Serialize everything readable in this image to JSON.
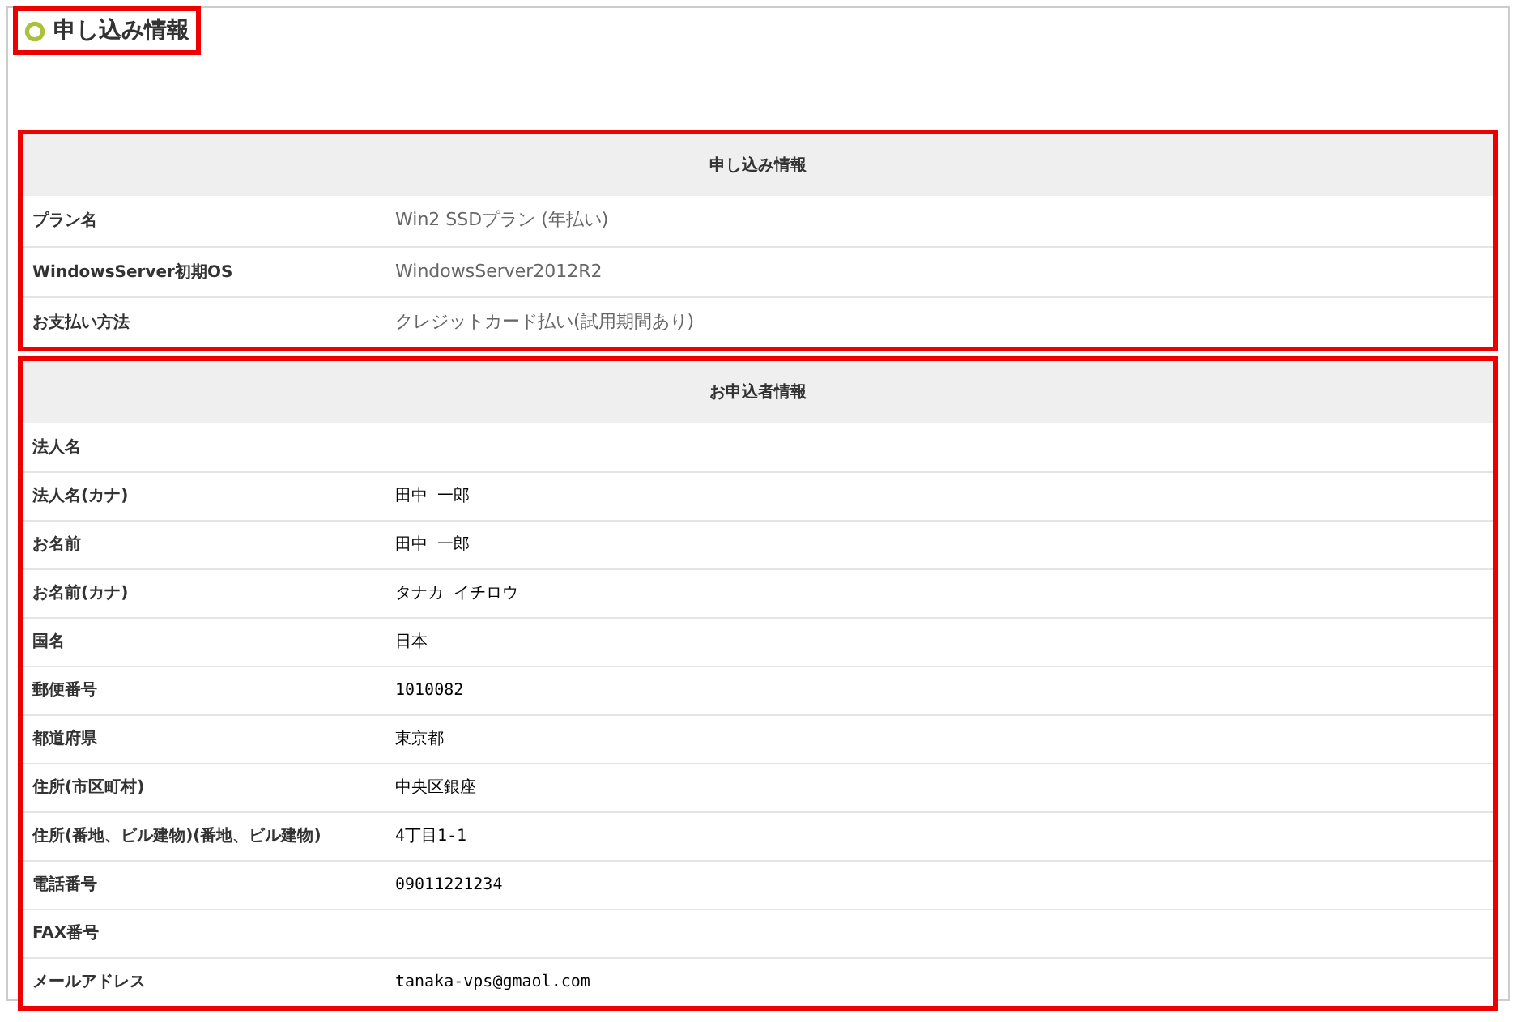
{
  "page_title": "申し込み情報",
  "sections": [
    {
      "title": "申し込み情報",
      "kind": "plan",
      "rows": [
        {
          "label": "プラン名",
          "value": "Win2 SSDプラン (年払い)"
        },
        {
          "label": "WindowsServer初期OS",
          "value": "WindowsServer2012R2"
        },
        {
          "label": "お支払い方法",
          "value": "クレジットカード払い(試用期間あり)"
        }
      ]
    },
    {
      "title": "お申込者情報",
      "kind": "applicant",
      "rows": [
        {
          "label": "法人名"
        },
        {
          "label": "法人名(カナ)",
          "value": "田中 一郎"
        },
        {
          "label": "お名前",
          "value": "田中 一郎"
        },
        {
          "label": "お名前(カナ)",
          "value": "タナカ イチロウ"
        },
        {
          "label": "国名",
          "value": "日本"
        },
        {
          "label": "郵便番号",
          "value": "1010082"
        },
        {
          "label": "都道府県",
          "value": "東京都"
        },
        {
          "label": "住所(市区町村)",
          "value": "中央区銀座"
        },
        {
          "label": "住所(番地、ビル建物)(番地、ビル建物)",
          "value": "4丁目1-1"
        },
        {
          "label": "電話番号",
          "value": "09011221234"
        },
        {
          "label": "FAX番号"
        },
        {
          "label": "メールアドレス",
          "value": "tanaka-vps@gmaol.com"
        }
      ]
    }
  ]
}
